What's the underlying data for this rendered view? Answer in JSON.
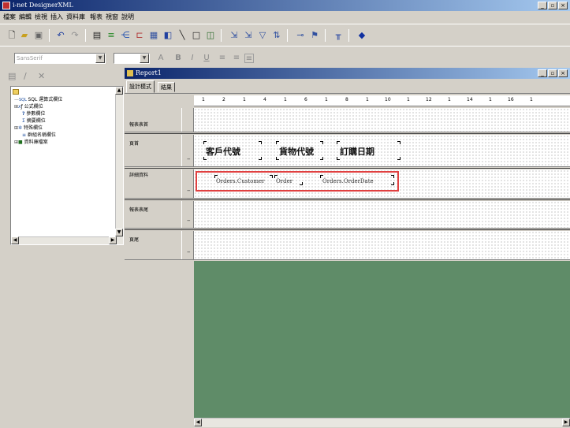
{
  "window": {
    "title": "i-net DesignerXML",
    "minimize_label": "_",
    "maximize_label": "▫",
    "close_label": "×"
  },
  "menu": {
    "items": [
      "檔案",
      "編輯",
      "檢視",
      "插入",
      "資料庫",
      "報表",
      "視窗",
      "說明"
    ]
  },
  "toolbar": {
    "icons": [
      "new-icon",
      "open-icon",
      "save-icon",
      "undo-icon",
      "redo-icon",
      "preview-icon",
      "insert-field-icon",
      "group-icon",
      "chart-icon",
      "table-icon",
      "image-icon",
      "line-icon",
      "box-icon",
      "subreport-icon",
      "sort-icon",
      "select-icon",
      "filter-icon",
      "summary-icon",
      "link-icon",
      "wizard-icon",
      "format-icon",
      "help-icon"
    ]
  },
  "formatbar": {
    "font_value": "SansSerif",
    "size_value": "",
    "style_labels": [
      "A",
      "B",
      "I",
      "U"
    ]
  },
  "tree": {
    "items": [
      "SQL 運算式欄位",
      "公式欄位",
      "參數欄位",
      "摘要欄位",
      "特殊欄位",
      "群組名稱欄位",
      "資料庫檔案"
    ]
  },
  "report": {
    "title": "Report1",
    "tabs": [
      "設計模式",
      "結果"
    ],
    "ruler": [
      "1",
      "2",
      "1",
      "4",
      "1",
      "6",
      "1",
      "8",
      "1",
      "10",
      "1",
      "12",
      "1",
      "14",
      "1",
      "16",
      "1"
    ],
    "sections": {
      "report_header": "報表表首",
      "page_header": "頁首",
      "details": "詳細資料",
      "report_footer": "報表表尾",
      "page_footer": "頁尾"
    },
    "header_fields": [
      "客戶代號",
      "貨物代號",
      "訂購日期"
    ],
    "detail_fields": [
      "Orders.Customer",
      "Order",
      "Orders.OrderDate"
    ]
  }
}
